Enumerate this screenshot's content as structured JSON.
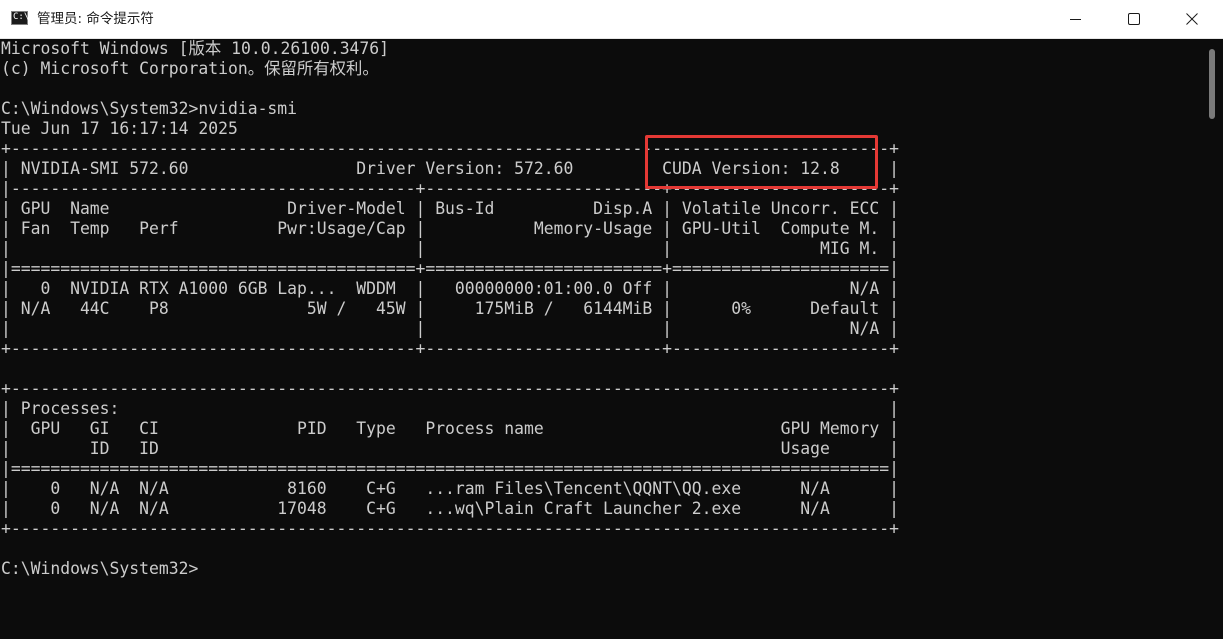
{
  "window": {
    "title": "管理员: 命令提示符",
    "icon": "cmd-icon",
    "icon_glyph": "C:\\"
  },
  "controls": {
    "minimize": "minimize-icon",
    "maximize": "maximize-icon",
    "close": "close-icon"
  },
  "console": {
    "lines": [
      "Microsoft Windows [版本 10.0.26100.3476]",
      "(c) Microsoft Corporation。保留所有权利。",
      "",
      "C:\\Windows\\System32>nvidia-smi",
      "Tue Jun 17 16:17:14 2025",
      "+-----------------------------------------------------------------------------------------+",
      "| NVIDIA-SMI 572.60                 Driver Version: 572.60         CUDA Version: 12.8     |",
      "|-----------------------------------------+------------------------+----------------------+",
      "| GPU  Name                  Driver-Model | Bus-Id          Disp.A | Volatile Uncorr. ECC |",
      "| Fan  Temp   Perf          Pwr:Usage/Cap |           Memory-Usage | GPU-Util  Compute M. |",
      "|                                         |                        |               MIG M. |",
      "|=========================================+========================+======================|",
      "|   0  NVIDIA RTX A1000 6GB Lap...  WDDM  |   00000000:01:00.0 Off |                  N/A |",
      "| N/A   44C    P8              5W /   45W |     175MiB /   6144MiB |      0%      Default |",
      "|                                         |                        |                  N/A |",
      "+-----------------------------------------+------------------------+----------------------+",
      "",
      "+-----------------------------------------------------------------------------------------+",
      "| Processes:                                                                              |",
      "|  GPU   GI   CI              PID   Type   Process name                        GPU Memory |",
      "|        ID   ID                                                               Usage      |",
      "|=========================================================================================|",
      "|    0   N/A  N/A            8160    C+G   ...ram Files\\Tencent\\QQNT\\QQ.exe      N/A      |",
      "|    0   N/A  N/A           17048    C+G   ...wq\\Plain Craft Launcher 2.exe      N/A      |",
      "+-----------------------------------------------------------------------------------------+",
      "",
      "C:\\Windows\\System32>"
    ]
  },
  "annotation": {
    "color": "#e53935",
    "target": "CUDA Version: 12.8"
  },
  "colors": {
    "console_bg": "#0c0c0c",
    "console_fg": "#cccccc",
    "titlebar_bg": "#ffffff"
  }
}
